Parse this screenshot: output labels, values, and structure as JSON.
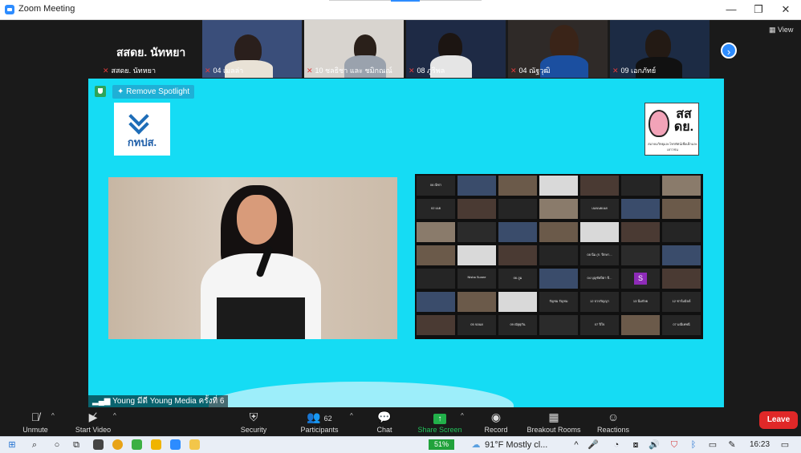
{
  "window": {
    "title": "Zoom Meeting",
    "controls": {
      "minimize": "—",
      "restore": "❐",
      "close": "✕"
    }
  },
  "top_strip": {
    "tiles": [
      {
        "name": "สสดย. นัทหยา",
        "display_name": "สสดย. นัทหยา"
      },
      {
        "name": "04 เมลล่า"
      },
      {
        "name": "10 ชลธิชา และ ชมิกณณ์"
      },
      {
        "name": "08 ภูริพล"
      },
      {
        "name": "04 ณัฐวุฒิ"
      },
      {
        "name": "09 เอกภัทย์"
      }
    ],
    "next_icon": "›",
    "view_label": "View"
  },
  "spotlight": {
    "remove_label": "Remove Spotlight",
    "logo_left_text": "กทปส.",
    "logo_right_text": "สส ดย.",
    "logo_right_sub": "สมาคมวิทยุและโทรทัศน์เพื่อเด็กและเยาวชน",
    "speaker_name": "Young มีดี Young Media ครั้งที่ 6",
    "gallery": [
      [
        "06 ณิชา",
        "",
        "",
        "",
        "",
        "",
        ""
      ],
      [
        "02 เนย",
        "",
        "",
        "",
        "เนยเนยเนย",
        "",
        ""
      ],
      [
        "",
        "",
        "",
        "",
        "",
        "",
        ""
      ],
      [
        "",
        "",
        "",
        "",
        "08 นิ่ม (ก. ปีกษา...",
        "",
        ""
      ],
      [
        "",
        "Nisha Sunee",
        "06 ภูม",
        "",
        "04 บุญชัยปีตา ปี...",
        "S",
        ""
      ],
      [
        "",
        "",
        "",
        "รัญชม รัญชม",
        "12 ปวรกัญญา",
        "13 นิ่มกัลย",
        "12 ชาร์มมิลล์"
      ],
      [
        "",
        "05 จอนย",
        "09 ณัฐธุกัน",
        "",
        "07 ปีใจ",
        "",
        "07 มณีเทพนี"
      ]
    ]
  },
  "toolbar": {
    "unmute": "Unmute",
    "start_video": "Start Video",
    "security": "Security",
    "participants": "Participants",
    "participants_count": "62",
    "chat": "Chat",
    "share_screen": "Share Screen",
    "record": "Record",
    "breakout_rooms": "Breakout Rooms",
    "reactions": "Reactions",
    "leave": "Leave",
    "caret": "^"
  },
  "taskbar": {
    "battery": "51%",
    "weather": "91°F  Mostly cl...",
    "time": "16:23"
  },
  "colors": {
    "spotlight_bg": "#15dcf4",
    "accent": "#2d8cff",
    "leave": "#e02828",
    "share": "#22b04a"
  }
}
